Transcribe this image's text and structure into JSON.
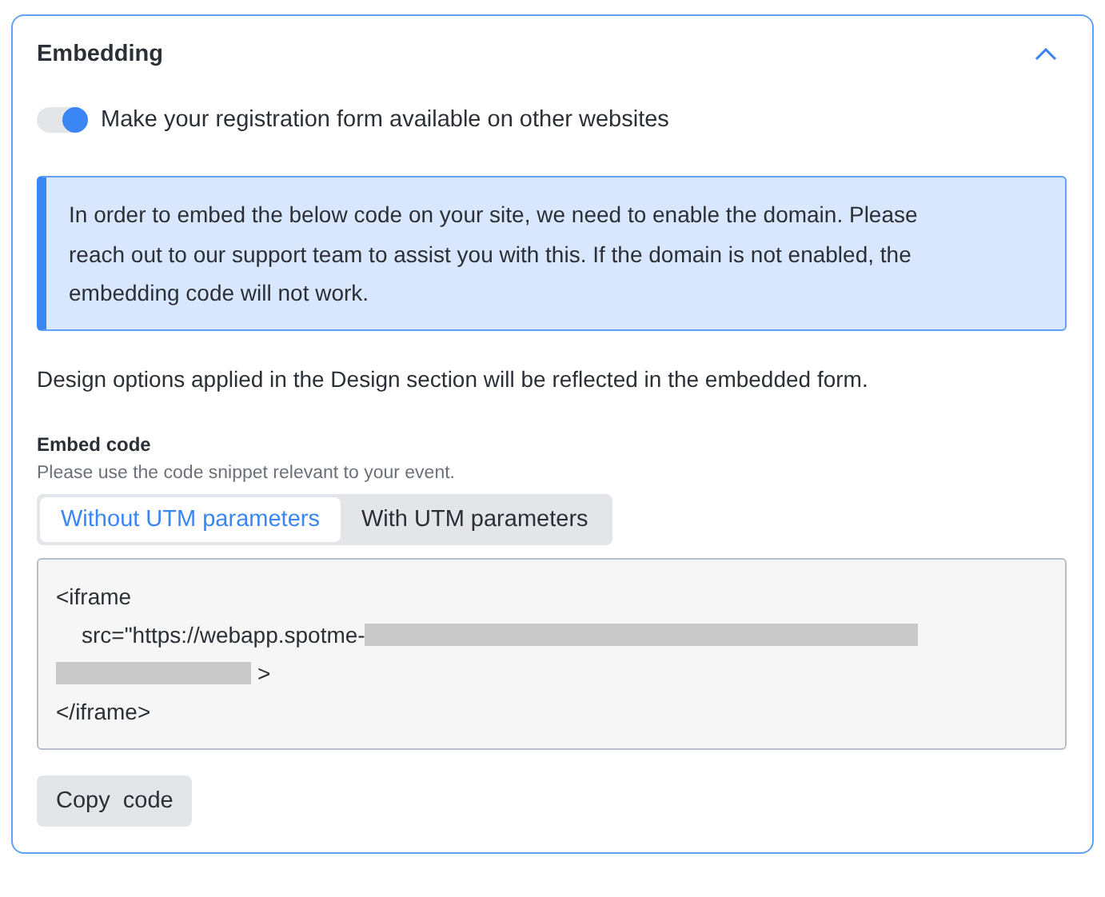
{
  "section": {
    "title": "Embedding",
    "expanded": true
  },
  "toggle": {
    "label": "Make your registration form available on other websites",
    "on": true
  },
  "notice": "In order to embed the below code on your site, we need to enable the domain. Please reach out to our support team to assist you with this. If the domain is not enabled, the embedding code will not work.",
  "design_note": "Design options applied in the Design section will be reflected in the embedded form.",
  "embed": {
    "label": "Embed code",
    "hint": "Please use the code snippet relevant to your event.",
    "tabs": [
      {
        "label": "Without UTM parameters",
        "selected": true
      },
      {
        "label": "With UTM parameters",
        "selected": false
      }
    ],
    "code_lines": [
      {
        "kind": "text",
        "text": "<iframe"
      },
      {
        "kind": "indented_redacted_end",
        "text": "src=\"https://webapp.spotme-"
      },
      {
        "kind": "redacted_start",
        "text": ">"
      },
      {
        "kind": "text",
        "text": "</iframe>"
      }
    ]
  },
  "copy_button": "Copy  code"
}
